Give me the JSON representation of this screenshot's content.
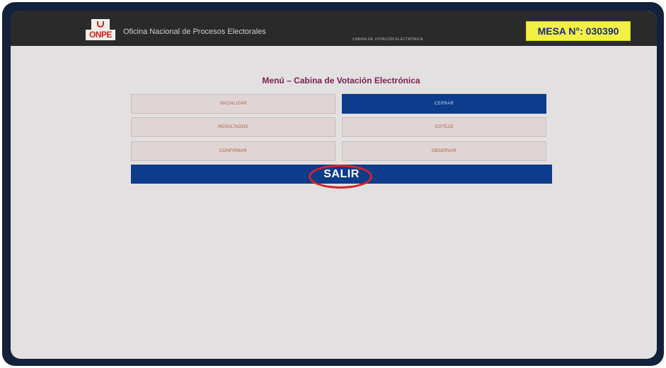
{
  "header": {
    "logo_text": "ONPE",
    "org_name": "Oficina Nacional de Procesos Electorales",
    "subtitle": "CABINA DE VOTACIÓN ELECTRÓNICA",
    "mesa": "MESA N°: 030390"
  },
  "menu": {
    "title": "Menú – Cabina de Votación Electrónica",
    "buttons": [
      {
        "label": "INICIALIZAR",
        "active": false
      },
      {
        "label": "CERRAR",
        "active": true
      },
      {
        "label": "RESULTADOS",
        "active": false
      },
      {
        "label": "COTEJO",
        "active": false
      },
      {
        "label": "CONFIRMAR",
        "active": false
      },
      {
        "label": "OBSERVAR",
        "active": false
      }
    ],
    "exit_label": "SALIR"
  },
  "colors": {
    "header_bg": "#2b2a2b",
    "screen_bg": "#e2e0e0",
    "accent_blue": "#0d3c8c",
    "mesa_badge": "#f2f044",
    "title_color": "#7b1f52",
    "button_text": "#b5533a",
    "highlight_ring": "#d8232a"
  }
}
